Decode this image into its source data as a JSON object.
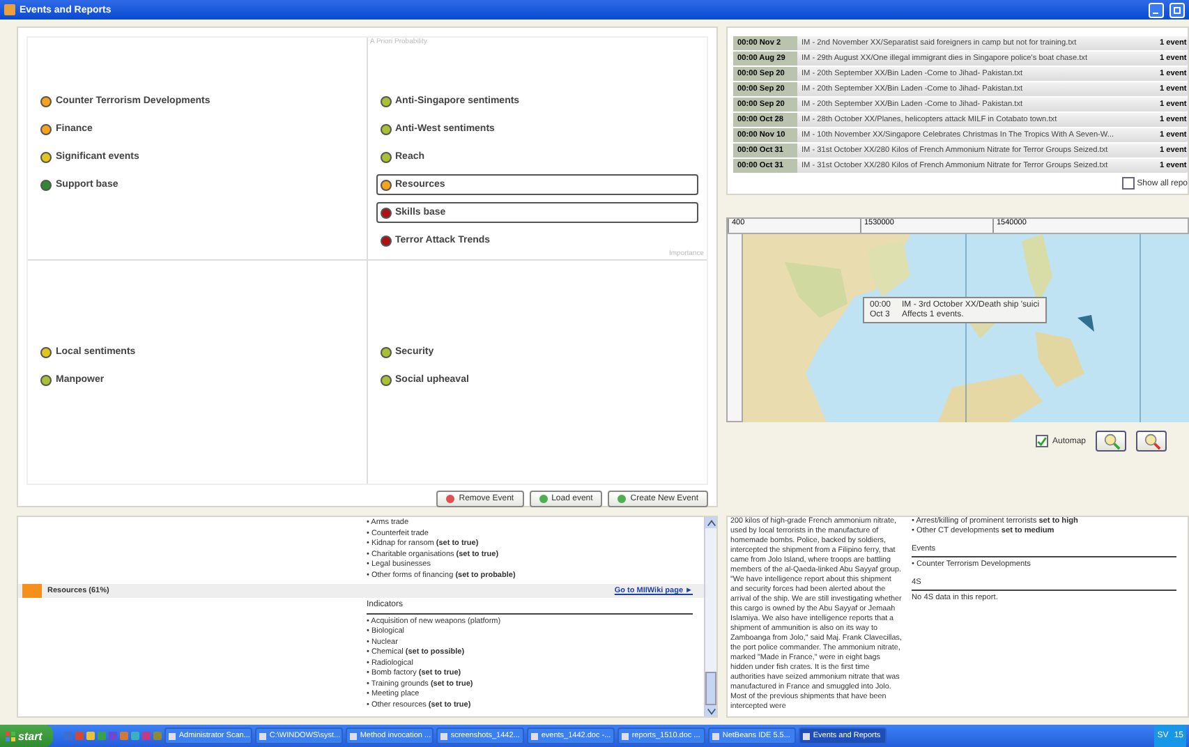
{
  "window": {
    "title": "Events and Reports"
  },
  "quadrant": {
    "y_axis_label": "A Priori Probability",
    "x_axis_label": "Importance",
    "quadrants": [
      {
        "items": [
          {
            "label": "Counter Terrorism Developments",
            "color": "#f5a21c",
            "selected": false
          },
          {
            "label": "Finance",
            "color": "#f5a21c",
            "selected": false
          },
          {
            "label": "Significant events",
            "color": "#e2c51e",
            "selected": false
          },
          {
            "label": "Support base",
            "color": "#2f8a2f",
            "selected": false
          }
        ]
      },
      {
        "items": [
          {
            "label": "Anti-Singapore sentiments",
            "color": "#a9c034",
            "selected": false
          },
          {
            "label": "Anti-West sentiments",
            "color": "#a9c034",
            "selected": false
          },
          {
            "label": "Reach",
            "color": "#a9c034",
            "selected": false
          },
          {
            "label": "Resources",
            "color": "#f5a21c",
            "selected": true
          },
          {
            "label": "Skills base",
            "color": "#b01212",
            "selected": true
          },
          {
            "label": "Terror Attack Trends",
            "color": "#b01212",
            "selected": false
          }
        ]
      },
      {
        "items": [
          {
            "label": "Local sentiments",
            "color": "#e2c51e",
            "selected": false
          },
          {
            "label": "Manpower",
            "color": "#a9c034",
            "selected": false
          }
        ]
      },
      {
        "items": [
          {
            "label": "Security",
            "color": "#a9c034",
            "selected": false
          },
          {
            "label": "Social upheaval",
            "color": "#a9c034",
            "selected": false
          }
        ]
      }
    ]
  },
  "event_buttons": [
    {
      "label": "Remove Event",
      "kind": "remove"
    },
    {
      "label": "Load event",
      "kind": "add"
    },
    {
      "label": "Create New Event",
      "kind": "add"
    }
  ],
  "events": [
    {
      "time": "00:00 Nov 2",
      "title": "IM - 2nd November XX/Separatist said foreigners in camp but not for training.txt",
      "count": "1 event"
    },
    {
      "time": "00:00 Aug 29",
      "title": "IM - 29th August XX/One illegal immigrant dies in Singapore police's boat chase.txt",
      "count": "1 event"
    },
    {
      "time": "00:00 Sep 20",
      "title": "IM - 20th September XX/Bin Laden -Come to Jihad- Pakistan.txt",
      "count": "1 event"
    },
    {
      "time": "00:00 Sep 20",
      "title": "IM - 20th September XX/Bin Laden -Come to Jihad- Pakistan.txt",
      "count": "1 event"
    },
    {
      "time": "00:00 Sep 20",
      "title": "IM - 20th September XX/Bin Laden -Come to Jihad- Pakistan.txt",
      "count": "1 event"
    },
    {
      "time": "00:00 Oct 28",
      "title": "IM - 28th October XX/Planes, helicopters attack MILF in Cotabato town.txt",
      "count": "1 event"
    },
    {
      "time": "00:00 Nov 10",
      "title": "IM - 10th November XX/Singapore Celebrates Christmas In The Tropics With A Seven-W...",
      "count": "1 event"
    },
    {
      "time": "00:00 Oct 31",
      "title": "IM - 31st October XX/280 Kilos of French Ammonium Nitrate for Terror Groups Seized.txt",
      "count": "1 event"
    },
    {
      "time": "00:00 Oct 31",
      "title": "IM - 31st October XX/280 Kilos of French Ammonium Nitrate for Terror Groups Seized.txt",
      "count": "1 event"
    }
  ],
  "show_all": {
    "label": "Show all repo",
    "checked": false
  },
  "map": {
    "ruler_labels": [
      "400",
      "1530000",
      "1540000"
    ],
    "tooltip": {
      "time": "00:00",
      "date": "Oct 3",
      "title": "IM - 3rd October XX/Death ship 'suici",
      "detail": "Affects 1 events."
    },
    "automap": {
      "label": "Automap",
      "checked": true
    }
  },
  "report": {
    "top_list": [
      "• Arms trade",
      "• Counterfeit trade",
      "• Kidnap for ransom **(set to true)**",
      "• Charitable organisations **(set to true)**",
      "• Legal businesses",
      "• Other forms of financing **(set to probable)**"
    ],
    "resource": {
      "label": "Resources (61%)",
      "color": "#f5901c",
      "link": "Go to MIIWiki page ►"
    },
    "indicators_heading": "Indicators",
    "indicators": [
      "• Acquisition of new weapons (platform)",
      "• Biological",
      "• Nuclear",
      "• Chemical **(set to possible)**",
      "• Radiological",
      "• Bomb factory **(set to true)**",
      "• Training grounds **(set to true)**",
      "• Meeting place",
      "• Other resources **(set to true)**"
    ]
  },
  "article": {
    "text": "200 kilos of high-grade French ammonium nitrate, used by local terrorists in the manufacture of homemade bombs. Police, backed by soldiers, intercepted the shipment from a Filipino ferry, that came from Jolo Island, where troops are battling members of the al-Qaeda-linked Abu Sayyaf group. \"We have intelligence report about this shipment and security forces had been alerted about the arrival of the ship. We are still investigating whether this cargo is owned by the Abu Sayyaf or Jemaah Islamiya. We also have intelligence reports that a shipment of ammunition is also on its way to Zamboanga from Jolo,\" said Maj. Frank Clavecillas, the port police commander. The ammonium nitrate, marked \"Made in France,\" were in eight bags hidden under fish crates. It is the first time authorities have seized ammonium nitrate that was manufactured in France and smuggled into Jolo. Most of the previous shipments that have been intercepted were",
    "side_list": [
      "• Arrest/killing of prominent terrorists **set to high**",
      "• Other CT developments **set to medium**"
    ],
    "events_heading": "Events",
    "events": [
      "• Counter Terrorism Developments"
    ],
    "s4_heading": "4S",
    "s4_text": "No 4S data in this report."
  },
  "taskbar": {
    "start": "start",
    "tasks": [
      {
        "label": "Administrator Scan...",
        "selected": false
      },
      {
        "label": "C:\\WINDOWS\\syst...",
        "selected": false
      },
      {
        "label": "Method invocation ...",
        "selected": false
      },
      {
        "label": "screenshots_1442...",
        "selected": false
      },
      {
        "label": "events_1442.doc -...",
        "selected": false
      },
      {
        "label": "reports_1510.doc ...",
        "selected": false
      },
      {
        "label": "NetBeans IDE 5.5...",
        "selected": false
      },
      {
        "label": "Events and Reports",
        "selected": true
      }
    ],
    "tray": [
      "SV",
      "15"
    ]
  }
}
